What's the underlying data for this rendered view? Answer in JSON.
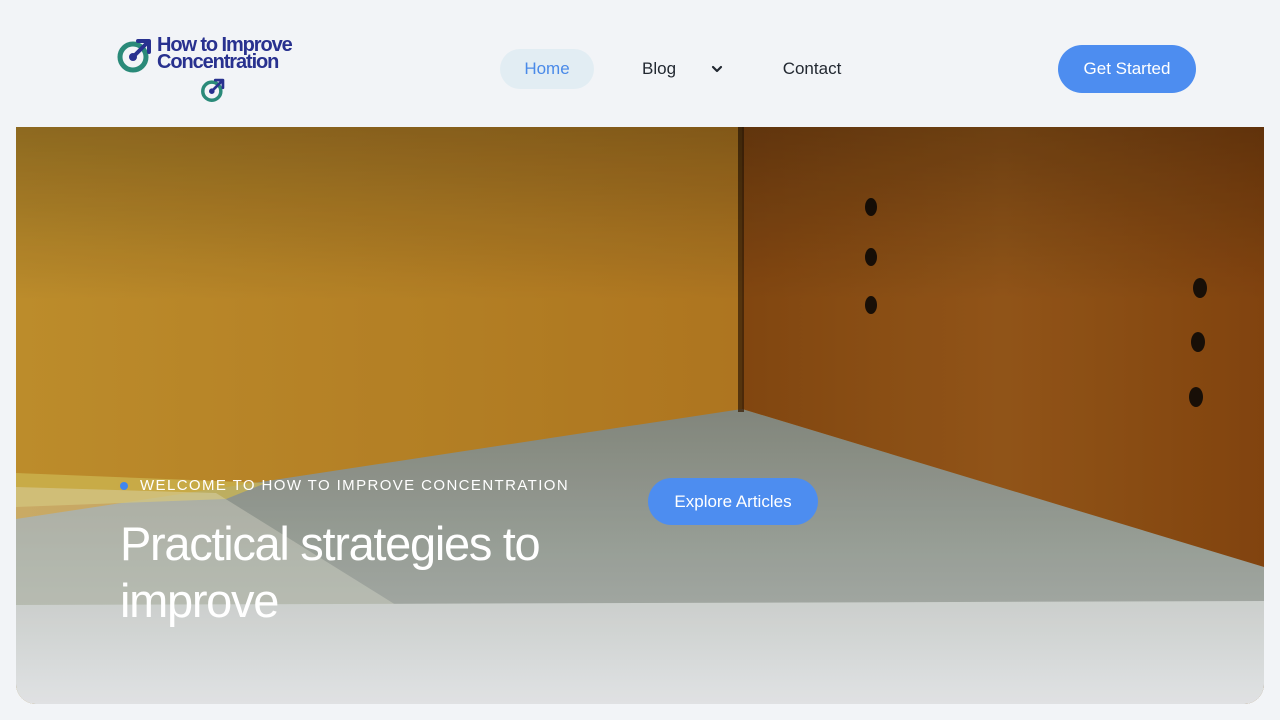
{
  "brand": {
    "name_line1": "How to Improve",
    "name_line2": "Concentration",
    "logo_icon": "target-arrow-icon",
    "colors": {
      "brand_navy": "#28318f",
      "brand_teal": "#2a8a79"
    }
  },
  "nav": {
    "items": [
      {
        "label": "Home",
        "active": true
      },
      {
        "label": "Blog",
        "has_dropdown": true,
        "icon": "chevron-down-icon"
      },
      {
        "label": "Contact"
      }
    ]
  },
  "header": {
    "cta_label": "Get Started"
  },
  "hero": {
    "eyebrow": "WELCOME TO HOW TO IMPROVE CONCENTRATION",
    "heading": "Practical strategies to improve",
    "cta_label": "Explore Articles"
  },
  "colors": {
    "accent": "#4d8df0",
    "page_bg": "#f2f4f7",
    "nav_active_bg": "#e2edf3"
  }
}
